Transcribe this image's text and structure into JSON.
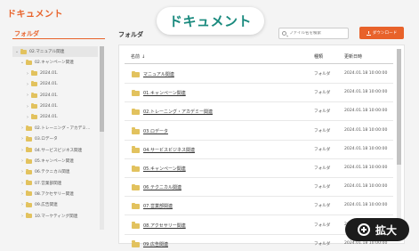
{
  "app": {
    "title": "ドキュメント",
    "hero_title": "ドキュメント"
  },
  "sidebar": {
    "heading": "フォルダ",
    "tree": [
      {
        "label": "02.マニュアル関連",
        "chev": "⌄",
        "indent": 0,
        "selected": true
      },
      {
        "label": "02.キャンペーン関連",
        "chev": "⌄",
        "indent": 1,
        "selected": false
      },
      {
        "label": "2024.01.",
        "chev": "›",
        "indent": 2,
        "selected": false
      },
      {
        "label": "2024.01.",
        "chev": "›",
        "indent": 2,
        "selected": false
      },
      {
        "label": "2024.01.",
        "chev": "›",
        "indent": 2,
        "selected": false
      },
      {
        "label": "2024.01.",
        "chev": "›",
        "indent": 2,
        "selected": false
      },
      {
        "label": "2024.01.",
        "chev": "›",
        "indent": 2,
        "selected": false
      },
      {
        "label": "02.トレーニング・アカデミ…",
        "chev": "›",
        "indent": 1,
        "selected": false
      },
      {
        "label": "03.ロデータ",
        "chev": "›",
        "indent": 1,
        "selected": false
      },
      {
        "label": "04.サービスビジネス関連",
        "chev": "›",
        "indent": 1,
        "selected": false
      },
      {
        "label": "05.キャンペーン関連",
        "chev": "›",
        "indent": 1,
        "selected": false
      },
      {
        "label": "06.テクニカル関連",
        "chev": "›",
        "indent": 1,
        "selected": false
      },
      {
        "label": "07.営業部関連",
        "chev": "›",
        "indent": 1,
        "selected": false
      },
      {
        "label": "08.アクセサリー関連",
        "chev": "›",
        "indent": 1,
        "selected": false
      },
      {
        "label": "09.広告関連",
        "chev": "›",
        "indent": 1,
        "selected": false
      },
      {
        "label": "10.マーケティング関連",
        "chev": "›",
        "indent": 1,
        "selected": false
      }
    ]
  },
  "main": {
    "heading": "フォルダ",
    "search_placeholder": "ファイル名を検索",
    "download_label": "ダウンロード",
    "columns": {
      "name": "名前",
      "sort_icon": "↓",
      "kind": "種類",
      "date": "更新日時"
    },
    "rows": [
      {
        "name": "マニュアル関連",
        "kind": "フォルダ",
        "date": "2024.01.18 10:00:00"
      },
      {
        "name": "01.キャンペーン関連",
        "kind": "フォルダ",
        "date": "2024.01.18 10:00:00"
      },
      {
        "name": "02.トレーニング・アカデミー関連",
        "kind": "フォルダ",
        "date": "2024.01.18 10:00:00"
      },
      {
        "name": "03.ロデータ",
        "kind": "フォルダ",
        "date": "2024.01.18 10:00:00"
      },
      {
        "name": "04.サービスビジネス関連",
        "kind": "フォルダ",
        "date": "2024.01.18 10:00:00"
      },
      {
        "name": "05.キャンペーン関連",
        "kind": "フォルダ",
        "date": "2024.01.18 10:00:00"
      },
      {
        "name": "06.テクニカル関連",
        "kind": "フォルダ",
        "date": "2024.01.18 10:00:00"
      },
      {
        "name": "07.営業部関連",
        "kind": "フォルダ",
        "date": "2024.01.18 10:00:00"
      },
      {
        "name": "08.アクセサリー関連",
        "kind": "フォルダ",
        "date": "2024.01.18 10:00:00"
      },
      {
        "name": "09.広告関連",
        "kind": "フォルダ",
        "date": "2024.01.18 10:00:00"
      }
    ]
  },
  "expand_button": {
    "label": "拡大",
    "icon": "plus-circle-icon"
  },
  "colors": {
    "accent": "#e8622a",
    "hero_text": "#1a8a7e",
    "folder": "#e2c25e",
    "expand_bg": "#1c1c1c"
  }
}
